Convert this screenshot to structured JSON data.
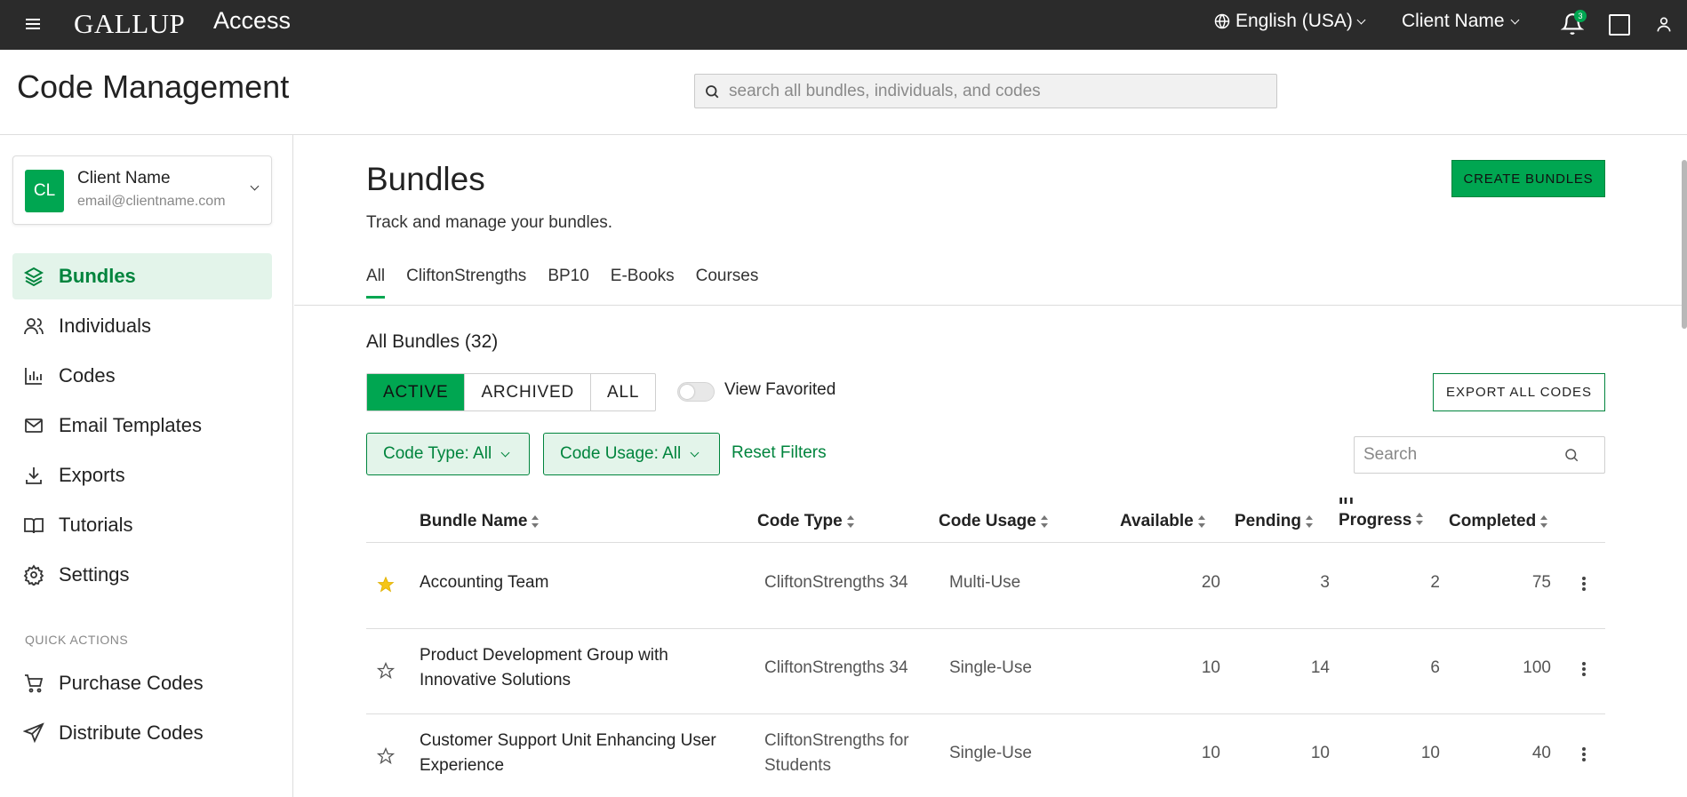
{
  "topbar": {
    "brand": "GALLUP",
    "app_name": "Access",
    "language": "English (USA)",
    "client": "Client Name",
    "notification_count": "3"
  },
  "header": {
    "title": "Code Management",
    "search_placeholder": "search all bundles, individuals, and codes"
  },
  "sidebar": {
    "client_card": {
      "initials": "CL",
      "name": "Client Name",
      "email": "email@clientname.com"
    },
    "items": [
      {
        "label": "Bundles",
        "icon": "layers-icon",
        "active": true
      },
      {
        "label": "Individuals",
        "icon": "users-icon"
      },
      {
        "label": "Codes",
        "icon": "bar-chart-icon"
      },
      {
        "label": "Email Templates",
        "icon": "mail-icon"
      },
      {
        "label": "Exports",
        "icon": "download-icon"
      },
      {
        "label": "Tutorials",
        "icon": "book-icon"
      },
      {
        "label": "Settings",
        "icon": "gear-icon"
      }
    ],
    "quick_actions_label": "QUICK ACTIONS",
    "quick_actions": [
      {
        "label": "Purchase Codes",
        "icon": "cart-icon"
      },
      {
        "label": "Distribute Codes",
        "icon": "send-icon"
      }
    ]
  },
  "main": {
    "title": "Bundles",
    "subtitle": "Track and manage your bundles.",
    "create_label": "CREATE BUNDLES",
    "tabs": [
      "All",
      "CliftonStrengths",
      "BP10",
      "E-Books",
      "Courses"
    ],
    "active_tab": "All",
    "count_label": "All Bundles (32)",
    "status_filters": [
      "ACTIVE",
      "ARCHIVED",
      "ALL"
    ],
    "active_status": "ACTIVE",
    "view_favorited_label": "View Favorited",
    "view_favorited_on": false,
    "export_label": "EXPORT ALL CODES",
    "filters": {
      "code_type": "Code Type: All",
      "code_usage": "Code Usage: All",
      "reset": "Reset Filters"
    },
    "table_search_placeholder": "Search",
    "columns": {
      "bundle_name": "Bundle Name",
      "code_type": "Code Type",
      "code_usage": "Code Usage",
      "available": "Available",
      "pending": "Pending",
      "in_progress_1": "In",
      "in_progress_2": "Progress",
      "completed": "Completed"
    },
    "rows": [
      {
        "favorite": true,
        "name_1": "Accounting Team",
        "name_2": "",
        "type_1": "CliftonStrengths 34",
        "type_2": "",
        "usage": "Multi-Use",
        "available": "20",
        "pending": "3",
        "in_progress": "2",
        "completed": "75"
      },
      {
        "favorite": false,
        "name_1": "Product Development Group with",
        "name_2": "Innovative Solutions",
        "type_1": "CliftonStrengths 34",
        "type_2": "",
        "usage": "Single-Use",
        "available": "10",
        "pending": "14",
        "in_progress": "6",
        "completed": "100"
      },
      {
        "favorite": false,
        "name_1": "Customer Support Unit Enhancing User",
        "name_2": "Experience",
        "type_1": "CliftonStrengths for",
        "type_2": "Students",
        "usage": "Single-Use",
        "available": "10",
        "pending": "10",
        "in_progress": "10",
        "completed": "40"
      }
    ]
  },
  "colors": {
    "accent": "#00a651",
    "accent_dark": "#00843d",
    "accent_light": "#e3f4ea",
    "topbar": "#2b2b2b",
    "star": "#f5c518"
  }
}
